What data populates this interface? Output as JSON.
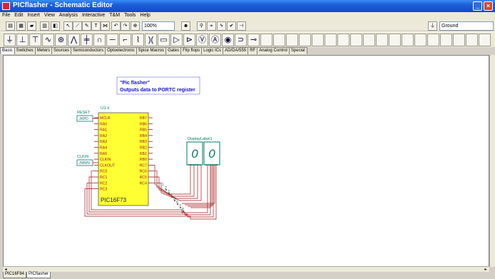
{
  "window": {
    "title": "PICflasher - Schematic Editor"
  },
  "menu": [
    "File",
    "Edit",
    "Insert",
    "View",
    "Analysis",
    "Interactive",
    "T&M",
    "Tools",
    "Help"
  ],
  "toolbar": {
    "zoom": "100%",
    "ground": "Ground"
  },
  "palette_tabs": [
    "Basic",
    "Switches",
    "Meters",
    "Sources",
    "Semiconductors",
    "Optoelectronic",
    "Spice Macros",
    "Gates",
    "Flip flops",
    "Logic ICs",
    "AD/DA/555",
    "RF",
    "Analog Control",
    "Special"
  ],
  "note": {
    "line1": "\"Pic flasher\"",
    "line2": "Outputs data to PORTC register"
  },
  "mcu": {
    "ref": "U1 x",
    "part": "PIC16F73",
    "left_pins": [
      "MCLR",
      "RA0",
      "RA1",
      "RA2",
      "RA3",
      "RA4",
      "RA5",
      "CLKIN",
      "CLKOUT",
      "RC0",
      "RC1",
      "RC2",
      "RC3"
    ],
    "right_pins": [
      "RB7",
      "RB6",
      "RB5",
      "RB4",
      "RB3",
      "RB2",
      "RB1",
      "RB0",
      "RC7",
      "RC6",
      "RC5",
      "RC4"
    ]
  },
  "inputs": {
    "reset_label": "RESET",
    "reset_box": "JKPD",
    "clk_label": "CLKIN",
    "clk_box": "JWWV"
  },
  "display": {
    "label": "DisplayLabel1",
    "digits": [
      "0",
      "0"
    ]
  },
  "wire_labels": [
    "1",
    "2",
    "3",
    "4",
    "5",
    "6",
    "7",
    "8"
  ],
  "sheet_tabs": [
    "PIC16F84",
    "PICflasher"
  ],
  "colors": {
    "title_blue": "#0f4bc8",
    "note_blue": "#1212d0",
    "mcu_fill": "#ffff33",
    "display_green": "#007a6a",
    "wire_red": "#a01818"
  }
}
